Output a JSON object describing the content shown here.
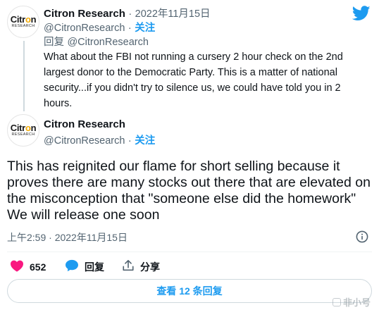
{
  "reply_tweet": {
    "avatar": {
      "brand_part1": "Citr",
      "brand_o": "o",
      "brand_part2": "n",
      "sub": "RESEARCH"
    },
    "author": "Citron Research",
    "date_sep": "·",
    "date": "2022年11月15日",
    "handle": "@CitronResearch",
    "handle_sep": "·",
    "follow": "关注",
    "reply_prefix": "回复",
    "reply_to": "@CitronResearch",
    "text": "What about the FBI not running a cursery 2 hour check on the 2nd largest donor to the Democratic Party. This is a matter of national security...if you didn't try to silence us, we could have told you in 2 hours."
  },
  "main_tweet": {
    "avatar": {
      "brand_part1": "Citr",
      "brand_o": "o",
      "brand_part2": "n",
      "sub": "RESEARCH"
    },
    "author": "Citron Research",
    "handle": "@CitronResearch",
    "handle_sep": "·",
    "follow": "关注",
    "text": "This has reignited our flame for short selling because it proves there are many stocks out there that are elevated on the misconception that \"someone else did the homework\" We will release one soon",
    "timestamp": "上午2:59 · 2022年11月15日"
  },
  "actions": {
    "likes": "652",
    "reply_label": "回复",
    "share_label": "分享"
  },
  "view_replies": "查看 12 条回复",
  "watermark": "非小号",
  "colors": {
    "accent": "#1d9bf0",
    "like": "#f91880",
    "text": "#0f1419",
    "muted": "#536471"
  },
  "icons": [
    "twitter-bird-icon",
    "info-icon",
    "heart-icon",
    "reply-bubble-icon",
    "share-icon"
  ]
}
